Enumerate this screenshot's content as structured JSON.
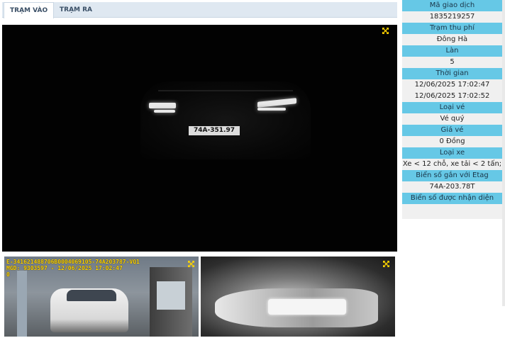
{
  "tabs": [
    {
      "label": "TRẠM VÀO",
      "active": true
    },
    {
      "label": "TRẠM RA",
      "active": false
    }
  ],
  "main_camera": {
    "plate_text": "74A-351.97"
  },
  "thumb_left": {
    "overlay_line1": "E-341621488706B0004069105-74A203787-VQ1",
    "overlay_line2": "MGD: 9303597 - 12/06/2025 17:02:47",
    "overlay_line3": "0"
  },
  "info": {
    "transaction_id_label": "Mã giao dịch",
    "transaction_id": "1835219257",
    "station_label": "Trạm thu phí",
    "station": "Đông Hà",
    "lane_label": "Làn",
    "lane": "5",
    "time_label": "Thời gian",
    "time_in": "12/06/2025 17:02:47",
    "time_out": "12/06/2025 17:02:52",
    "ticket_type_label": "Loại vé",
    "ticket_type": "Vé quý",
    "price_label": "Giá vé",
    "price": "0 Đồng",
    "vehicle_type_label": "Loại xe",
    "vehicle_type": "Xe < 12 chỗ, xe tải < 2 tấn;",
    "etag_plate_label": "Biển số gắn với Etag",
    "etag_plate": "74A-203.78T",
    "recognized_plate_label": "Biển số được nhận diện",
    "recognized_plate": ""
  },
  "colors": {
    "label_bg": "#66c8e6",
    "overlay_text": "#ffd400",
    "expand_icon": "#ffd400"
  },
  "icons": {
    "expand": "expand-arrows-icon"
  }
}
